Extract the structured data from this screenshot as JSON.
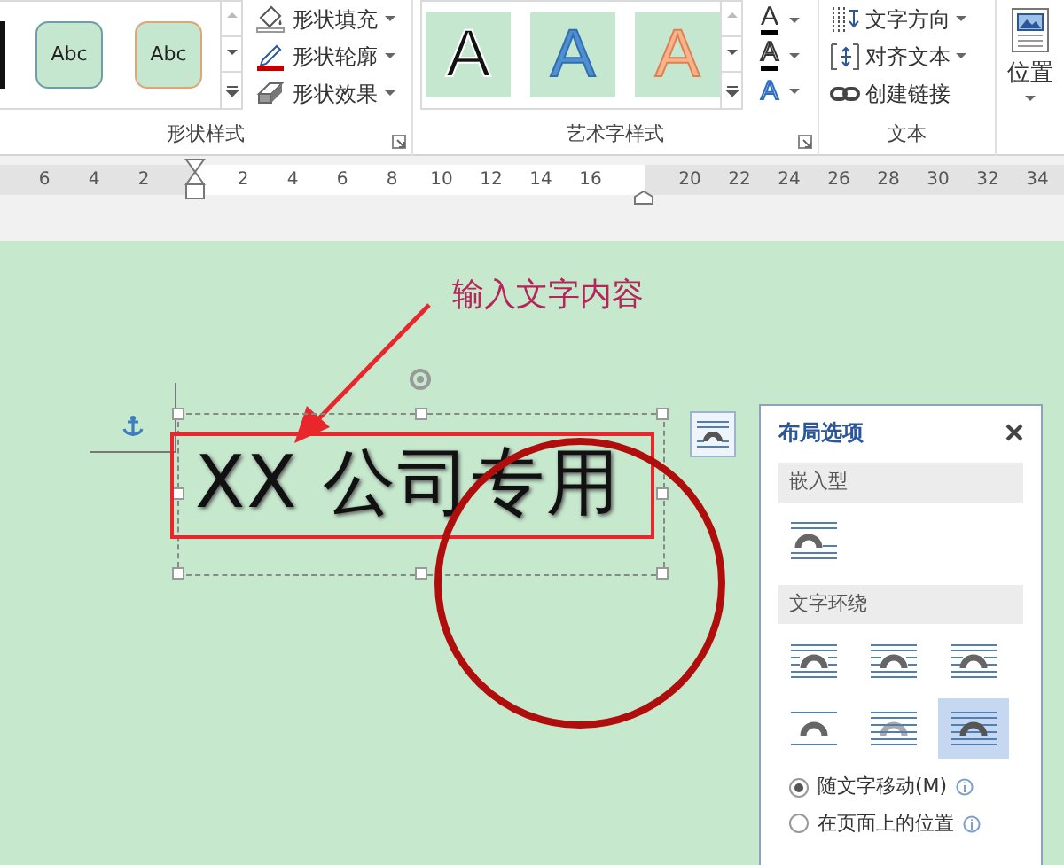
{
  "ribbon": {
    "shape_styles": {
      "label": "形状样式",
      "gallery": [
        {
          "text": "Abc",
          "color": "#6f9ea6"
        },
        {
          "text": "Abc",
          "color": "#e0a574"
        }
      ],
      "commands": [
        {
          "kind": "fill",
          "label": "形状填充"
        },
        {
          "kind": "outline",
          "label": "形状轮廓"
        },
        {
          "kind": "effects",
          "label": "形状效果"
        }
      ]
    },
    "wordart_styles": {
      "label": "艺术字样式",
      "gallery": [
        {
          "text": "A",
          "color": "#111111"
        },
        {
          "text": "A",
          "color": "#4f8fd2"
        },
        {
          "text": "A",
          "color": "#f7b48c"
        }
      ],
      "tools": [
        {
          "kind": "fill",
          "text": "A"
        },
        {
          "kind": "outline",
          "text": "A"
        },
        {
          "kind": "effects",
          "text": "A"
        }
      ]
    },
    "text": {
      "label": "文本",
      "commands": [
        {
          "kind": "direction",
          "label": "文字方向",
          "dropdown": true
        },
        {
          "kind": "align",
          "label": "对齐文本",
          "dropdown": true
        },
        {
          "kind": "link",
          "label": "创建链接",
          "dropdown": false
        }
      ]
    },
    "position": {
      "label": "位置"
    }
  },
  "ruler": {
    "left_numbers": [
      "6",
      "4",
      "2"
    ],
    "body_numbers": [
      "2",
      "4",
      "6",
      "8",
      "10",
      "12",
      "14",
      "16"
    ],
    "right_numbers": [
      "20",
      "22",
      "24",
      "26",
      "28",
      "30",
      "32",
      "34"
    ]
  },
  "document": {
    "annotation": "输入文字内容",
    "text_box": {
      "text": "XX 公司专用"
    }
  },
  "layout_options": {
    "title": "布局选项",
    "sections": [
      {
        "title": "嵌入型",
        "options": [
          {
            "selected": false
          }
        ]
      },
      {
        "title": "文字环绕",
        "options": [
          {
            "selected": false
          },
          {
            "selected": false
          },
          {
            "selected": false
          },
          {
            "selected": false
          },
          {
            "selected": false
          },
          {
            "selected": true
          }
        ]
      }
    ],
    "radios": [
      {
        "label": "随文字移动(M)",
        "selected": true
      },
      {
        "label": "在页面上的位置",
        "selected": false
      }
    ]
  }
}
